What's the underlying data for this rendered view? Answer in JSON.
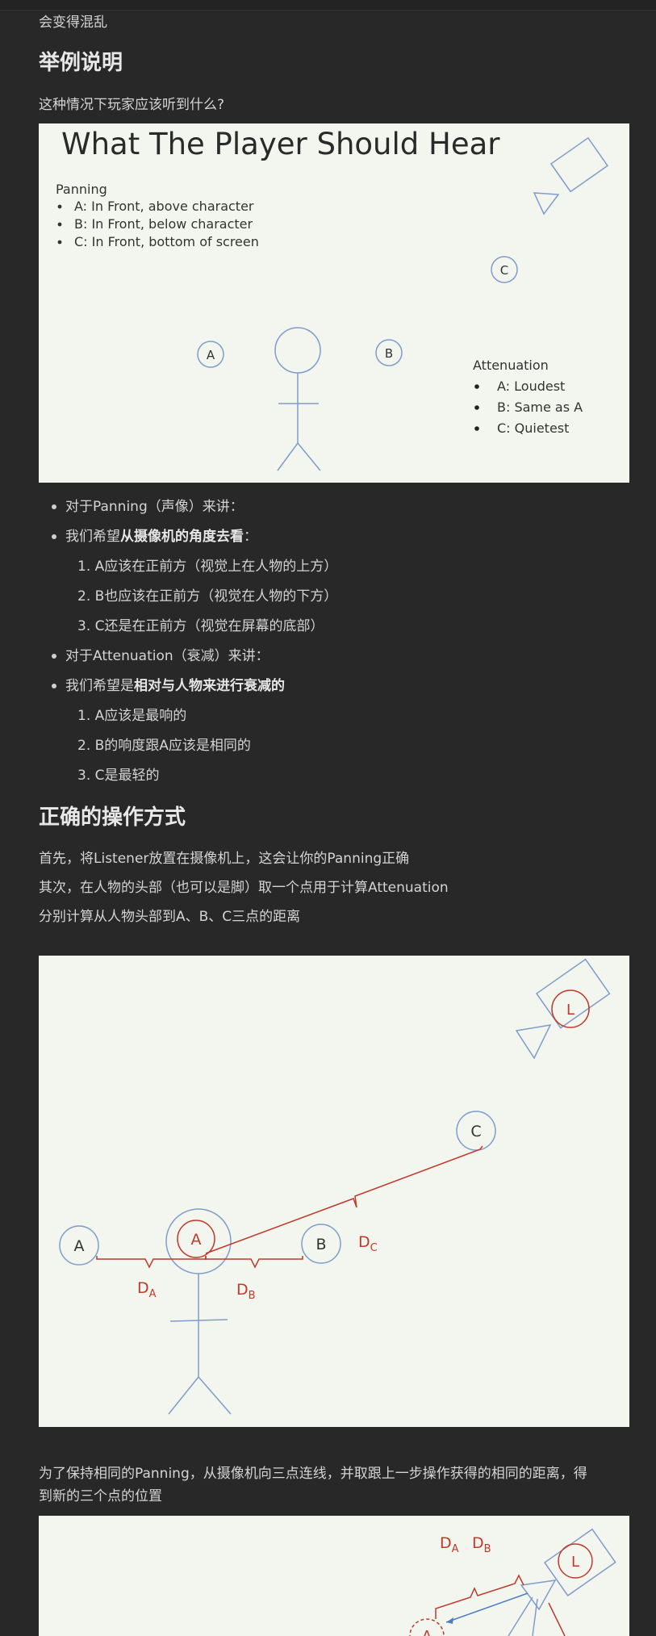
{
  "doc": {
    "intro_tail": "会变得混乱",
    "heading_example": "举例说明",
    "question": "这种情况下玩家应该听到什么?",
    "slide": {
      "title": "What The Player Should Hear",
      "panning_title": "Panning",
      "panning_items": [
        "A: In Front, above character",
        "B: In Front, below character",
        "C: In Front, bottom of screen"
      ],
      "attenuation_title": "Attenuation",
      "attenuation_items": [
        "A: Loudest",
        "B: Same as A",
        "C: Quietest"
      ],
      "labels": {
        "a": "A",
        "b": "B",
        "c": "C"
      }
    },
    "bullets": {
      "b1": "对于Panning（声像）来讲：",
      "b2_pre": "我们希望",
      "b2_bold": "从摄像机的角度去看",
      "b2_post": "：",
      "panning_list": [
        "A应该在正前方（视觉上在人物的上方）",
        "B也应该在正前方（视觉在人物的下方）",
        "C还是在正前方（视觉在屏幕的底部）"
      ],
      "b3": "对于Attenuation（衰减）来讲：",
      "b4_pre": "我们希望是",
      "b4_bold": "相对与人物来进行衰减的",
      "atten_list": [
        "A应该是最响的",
        "B的响度跟A应该是相同的",
        "C是最轻的"
      ]
    },
    "heading_correct": "正确的操作方式",
    "step1": "首先，将Listener放置在摄像机上，这会让你的Panning正确",
    "step2": "其次，在人物的头部（也可以是脚）取一个点用于计算Attenuation",
    "step3": "分别计算从人物头部到A、B、C三点的距离",
    "diagram2": {
      "a": "A",
      "b": "B",
      "c": "C",
      "l": "L",
      "a_inner": "A",
      "da": "D",
      "da_sub": "A",
      "db": "D",
      "db_sub": "B",
      "dc": "D",
      "dc_sub": "C"
    },
    "step4_line1": "为了保持相同的Panning，从摄像机向三点连线，并取跟上一步操作获得的相同的距离，得",
    "step4_line2": "到新的三个点的位置",
    "diagram3": {
      "da": "D",
      "da_sub": "A",
      "db": "D",
      "db_sub": "B",
      "l": "L",
      "a": "A"
    }
  }
}
